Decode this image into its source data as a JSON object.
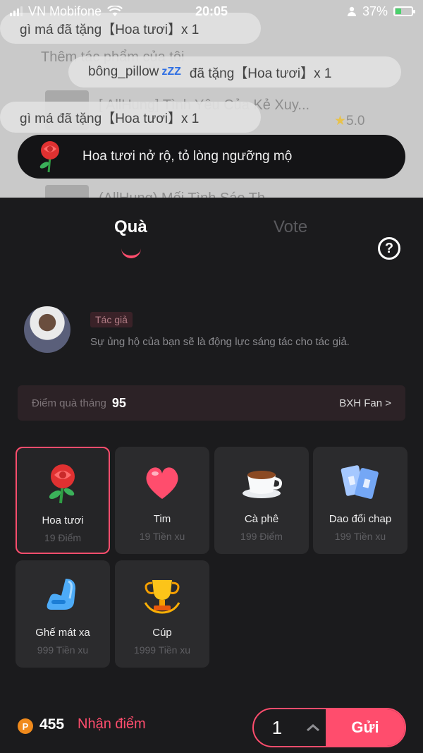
{
  "status_bar": {
    "carrier": "VN Mobifone",
    "time": "20:05",
    "battery": "37%",
    "battery_level": 0.37
  },
  "background": {
    "section_title": "Thêm tác phẩm của tôi",
    "story1_title": "[ AllHung] Tình Yêu Của Kẻ Xuy...",
    "story1_rating": "5.0",
    "story2_title": "(AllHung) Mối Tình Sáo Th..."
  },
  "toasts": [
    {
      "text": "gì má đã tặng【Hoa tươi】x 1"
    },
    {
      "user": "bông_pillow",
      "zzz": "zZZ",
      "text": "đã tặng【Hoa tươi】x 1"
    },
    {
      "text": "gì má đã tặng【Hoa tươi】x 1"
    }
  ],
  "announcement": {
    "text": "Hoa tươi nở rộ, tỏ lòng ngưỡng mộ"
  },
  "tabs": {
    "gift": "Quà",
    "vote": "Vote",
    "help": "?"
  },
  "author": {
    "badge": "Tác giả",
    "description": "Sự ủng hộ của bạn sẽ là động lực sáng tác cho tác giả."
  },
  "monthly_points": {
    "label": "Điểm quà tháng",
    "value": "95",
    "fan_link": "BXH Fan >"
  },
  "gifts": [
    {
      "name": "Hoa tươi",
      "price": "19 Điểm",
      "icon": "rose-icon",
      "selected": true
    },
    {
      "name": "Tim",
      "price": "19 Tiền xu",
      "icon": "heart-icon",
      "selected": false
    },
    {
      "name": "Cà phê",
      "price": "199 Điểm",
      "icon": "coffee-icon",
      "selected": false
    },
    {
      "name": "Dao đổi chap",
      "price": "199 Tiền xu",
      "icon": "blade-icon",
      "selected": false
    },
    {
      "name": "Ghế mát xa",
      "price": "999 Tiền xu",
      "icon": "massage-chair-icon",
      "selected": false
    },
    {
      "name": "Cúp",
      "price": "1999 Tiền xu",
      "icon": "trophy-icon",
      "selected": false
    }
  ],
  "bottom": {
    "coin_symbol": "P",
    "balance": "455",
    "earn_label": "Nhận điểm",
    "quantity": "1",
    "send_label": "Gửi"
  },
  "colors": {
    "accent": "#ff4d6d",
    "sheet_bg": "#1b1b1d",
    "card_bg": "#2b2b2d"
  }
}
